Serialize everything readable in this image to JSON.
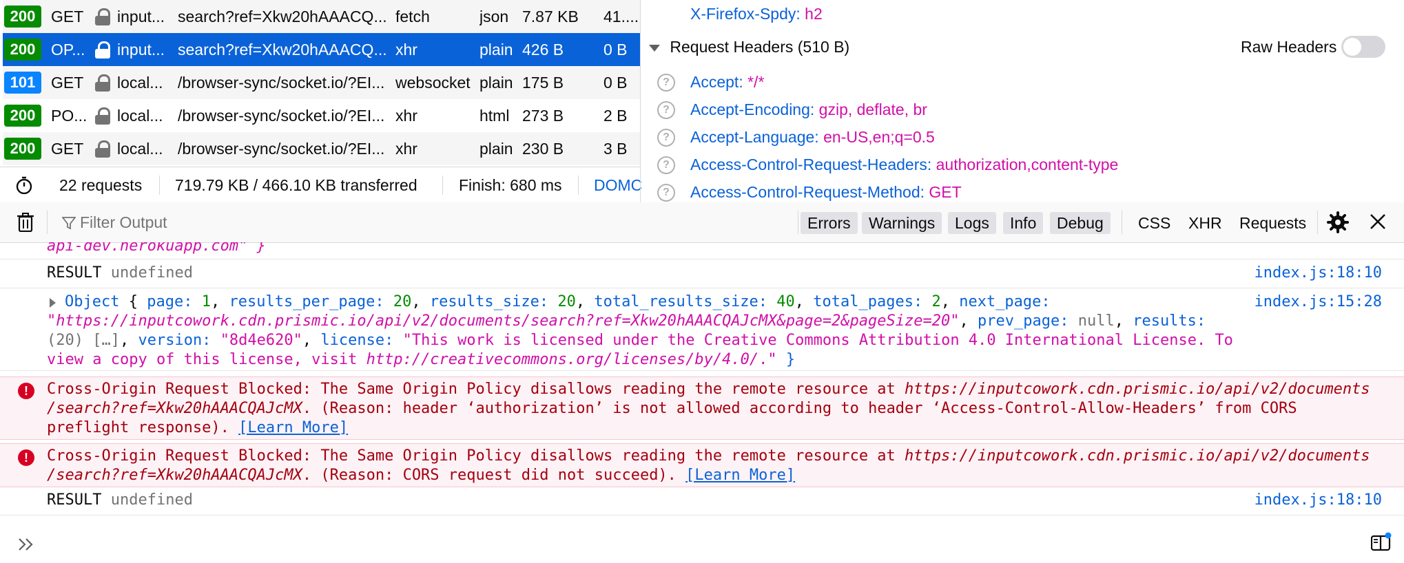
{
  "requests": [
    {
      "status": "200",
      "status_type": "ok",
      "method": "GET",
      "domain": "input...",
      "file": "search?ref=Xkw20hAAACQ...",
      "cause": "fetch",
      "type": "json",
      "transferred": "7.87 KB",
      "size": "41...."
    },
    {
      "status": "200",
      "status_type": "ok",
      "method": "OP...",
      "domain": "input...",
      "file": "search?ref=Xkw20hAAACQ...",
      "cause": "xhr",
      "type": "plain",
      "transferred": "426 B",
      "size": "0 B",
      "selected": true
    },
    {
      "status": "101",
      "status_type": "info",
      "method": "GET",
      "domain": "local...",
      "file": "/browser-sync/socket.io/?EI...",
      "cause": "websocket",
      "type": "plain",
      "transferred": "175 B",
      "size": "0 B"
    },
    {
      "status": "200",
      "status_type": "ok",
      "method": "PO...",
      "domain": "local...",
      "file": "/browser-sync/socket.io/?EI...",
      "cause": "xhr",
      "type": "html",
      "transferred": "273 B",
      "size": "2 B"
    },
    {
      "status": "200",
      "status_type": "ok",
      "method": "GET",
      "domain": "local...",
      "file": "/browser-sync/socket.io/?EI...",
      "cause": "xhr",
      "type": "plain",
      "transferred": "230 B",
      "size": "3 B"
    }
  ],
  "summary": {
    "requests": "22 requests",
    "transferred": "719.79 KB / 466.10 KB transferred",
    "finish": "Finish: 680 ms",
    "dom": "DOMC"
  },
  "headers": {
    "prev_name": "X-Firefox-Spdy:",
    "prev_value": "h2",
    "section_title": "Request Headers (510 B)",
    "raw_label": "Raw Headers",
    "rows": [
      {
        "name": "Accept:",
        "value": "*/*"
      },
      {
        "name": "Accept-Encoding:",
        "value": "gzip, deflate, br"
      },
      {
        "name": "Accept-Language:",
        "value": "en-US,en;q=0.5"
      },
      {
        "name": "Access-Control-Request-Headers:",
        "value": "authorization,content-type"
      },
      {
        "name": "Access-Control-Request-Method:",
        "value": "GET"
      }
    ]
  },
  "toolbar": {
    "filter_placeholder": "Filter Output",
    "levels": [
      "Errors",
      "Warnings",
      "Logs",
      "Info",
      "Debug"
    ],
    "extras": [
      "CSS",
      "XHR",
      "Requests"
    ]
  },
  "console": {
    "partial_line": "api-dev.herokuapp.com\" }",
    "result1_key": "RESULT",
    "result1_val": "undefined",
    "result1_loc": "index.js:18:10",
    "obj_loc": "index.js:15:28",
    "obj": {
      "label": "Object",
      "page_key": "page:",
      "page_val": "1",
      "rpp_key": "results_per_page:",
      "rpp_val": "20",
      "rs_key": "results_size:",
      "rs_val": "20",
      "trs_key": "total_results_size:",
      "trs_val": "40",
      "tp_key": "total_pages:",
      "tp_val": "2",
      "np_key": "next_page:",
      "np_val": "\"https://inputcowork.cdn.prismic.io/api/v2/documents/search?ref=Xkw20hAAACQAJcMX&page=2&pageSize=20\"",
      "pp_key": "prev_page:",
      "pp_val": "null",
      "res_key": "results:",
      "res_val": "(20) […]",
      "ver_key": "version:",
      "ver_val": "\"8d4e620\"",
      "lic_key": "license:",
      "lic_val1": "\"This work is licensed under the Creative Commons Attribution 4.0 International License. To",
      "lic_val2a": "view a copy of this license, visit ",
      "lic_url": "http://creativecommons.org/licenses/by/4.0/",
      "lic_val2b": ".\"",
      "close": "}"
    },
    "err1": {
      "text1": "Cross-Origin Request Blocked: The Same Origin Policy disallows reading the remote resource at ",
      "url1": "https://inputcowork.cdn.prismic.io/api/v2/documents",
      "url2": "/search?ref=Xkw20hAAACQAJcMX",
      "text2": ". (Reason: header ‘authorization’ is not allowed according to header ‘Access-Control-Allow-Headers’ from CORS",
      "text3": "preflight response). ",
      "learn": "[Learn More]"
    },
    "err2": {
      "text1": "Cross-Origin Request Blocked: The Same Origin Policy disallows reading the remote resource at ",
      "url1": "https://inputcowork.cdn.prismic.io/api/v2/documents",
      "url2": "/search?ref=Xkw20hAAACQAJcMX",
      "text2": ". (Reason: CORS request did not succeed). ",
      "learn": "[Learn More]"
    },
    "result2_key": "RESULT",
    "result2_val": "undefined",
    "result2_loc": "index.js:18:10"
  },
  "colors": {
    "selected_row": "#0a62d8",
    "status_ok": "#058b00",
    "status_info": "#0a84ff",
    "error_bg": "#fdf2f5",
    "error_text": "#a4000f"
  }
}
